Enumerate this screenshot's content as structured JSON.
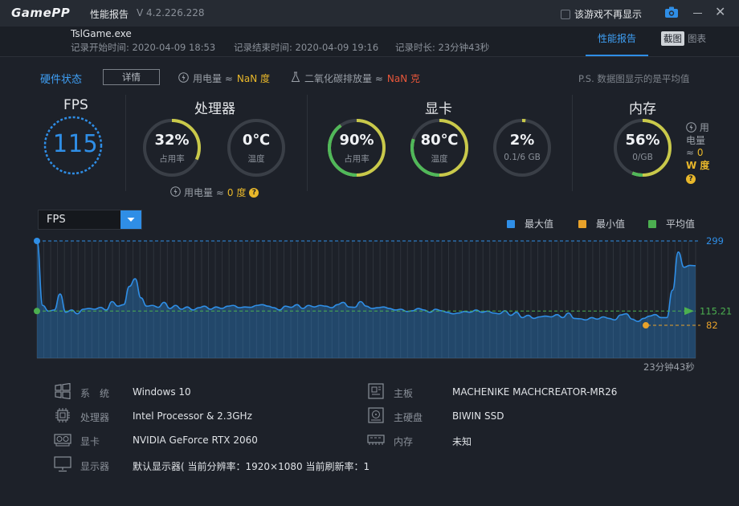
{
  "titlebar": {
    "logo_game": "Game",
    "logo_pp": "PP",
    "title": "性能报告",
    "version": "V 4.2.226.228",
    "no_show_label": "该游戏不再显示"
  },
  "info": {
    "game": "TslGame.exe",
    "start_label": "记录开始时间: 2020-04-09 18:53",
    "end_label": "记录结束时间: 2020-04-09 19:16",
    "duration_label": "记录时长: 23分钟43秒",
    "tabs": {
      "report": "性能报告",
      "screenshot": "截图",
      "chart": "图表"
    }
  },
  "summary": {
    "title": "硬件状态",
    "detail": "详情",
    "power_label": "用电量 ≈",
    "power_value": "NaN 度",
    "co2_label": "二氧化碳排放量 ≈",
    "co2_value": "NaN 克",
    "note": "P.S. 数据图显示的是平均值"
  },
  "sections": {
    "fps": {
      "title": "FPS",
      "value": "115"
    },
    "cpu": {
      "title": "处理器",
      "usage": {
        "value": "32%",
        "label": "占用率",
        "fraction": 0.32
      },
      "temp": {
        "value": "0℃",
        "label": "温度",
        "fraction": 0
      },
      "power_label": "用电量 ≈",
      "power_value": "0 度"
    },
    "gpu": {
      "title": "显卡",
      "usage": {
        "value": "90%",
        "label": "占用率",
        "fraction": 0.9
      },
      "temp": {
        "value": "80℃",
        "label": "温度",
        "fraction": 0.8
      },
      "vram": {
        "value": "2%",
        "label": "0.1/6 GB",
        "fraction": 0.02
      }
    },
    "mem": {
      "title": "内存",
      "usage": {
        "value": "56%",
        "label": "0/GB",
        "fraction": 0.56
      },
      "power_l1": "用",
      "power_l2": "电量",
      "power_l3": "≈",
      "power_l4": "0",
      "power_l5": "W 度"
    }
  },
  "chart_select": "FPS",
  "legend": {
    "max": "最大值",
    "min": "最小值",
    "avg": "平均值"
  },
  "colors": {
    "accent": "#2f8ee6",
    "yellow": "#e8b72a",
    "green": "#4caf50",
    "ring_yellow": "#c9c94a",
    "ring_green": "#4fb85a"
  },
  "chart_data": {
    "type": "area",
    "y_max_label": "299",
    "y_avg_label": "115.21",
    "y_min_label": "82",
    "x_end_label": "23分钟43秒",
    "ylim": [
      82,
      299
    ],
    "max": 299,
    "avg": 115.21,
    "min": 82,
    "values": [
      299,
      130,
      115,
      118,
      160,
      112,
      118,
      108,
      120,
      122,
      120,
      125,
      118,
      140,
      128,
      132,
      180,
      200,
      150,
      128,
      130,
      125,
      138,
      122,
      130,
      120,
      126,
      118,
      124,
      128,
      120,
      126,
      122,
      128,
      130,
      124,
      126,
      125,
      130,
      132,
      128,
      124,
      118,
      128,
      125,
      132,
      122,
      130,
      126,
      130,
      128,
      124,
      132,
      138,
      126,
      125,
      140,
      128,
      122,
      124,
      126,
      122,
      118,
      120,
      114,
      116,
      122,
      118,
      112,
      120,
      116,
      112,
      108,
      110,
      114,
      112,
      118,
      112,
      115,
      110,
      108,
      116,
      104,
      112,
      98,
      104,
      96,
      100,
      102,
      100,
      106,
      98,
      110,
      96,
      95,
      92,
      98,
      94,
      100,
      96,
      92,
      105,
      108,
      94,
      88,
      96,
      102,
      106,
      98,
      98,
      170,
      270,
      230,
      235,
      234
    ]
  },
  "hardware": [
    {
      "key": "系　统",
      "value": "Windows 10",
      "icon": "windows-icon"
    },
    {
      "key": "处理器",
      "value": "Intel Processor & 2.3GHz",
      "icon": "cpu-icon"
    },
    {
      "key": "显卡",
      "value": "NVIDIA GeForce RTX 2060",
      "icon": "gpu-icon"
    },
    {
      "key": "显示器",
      "value": "默认显示器( 当前分辨率：1920×1080 当前刷新率：1",
      "icon": "monitor-icon"
    },
    {
      "key": "主板",
      "value": "MACHENIKE MACHCREATOR-MR26",
      "icon": "motherboard-icon"
    },
    {
      "key": "主硬盘",
      "value": "BIWIN SSD",
      "icon": "disk-icon"
    },
    {
      "key": "内存",
      "value": "未知",
      "icon": "memory-icon"
    }
  ]
}
